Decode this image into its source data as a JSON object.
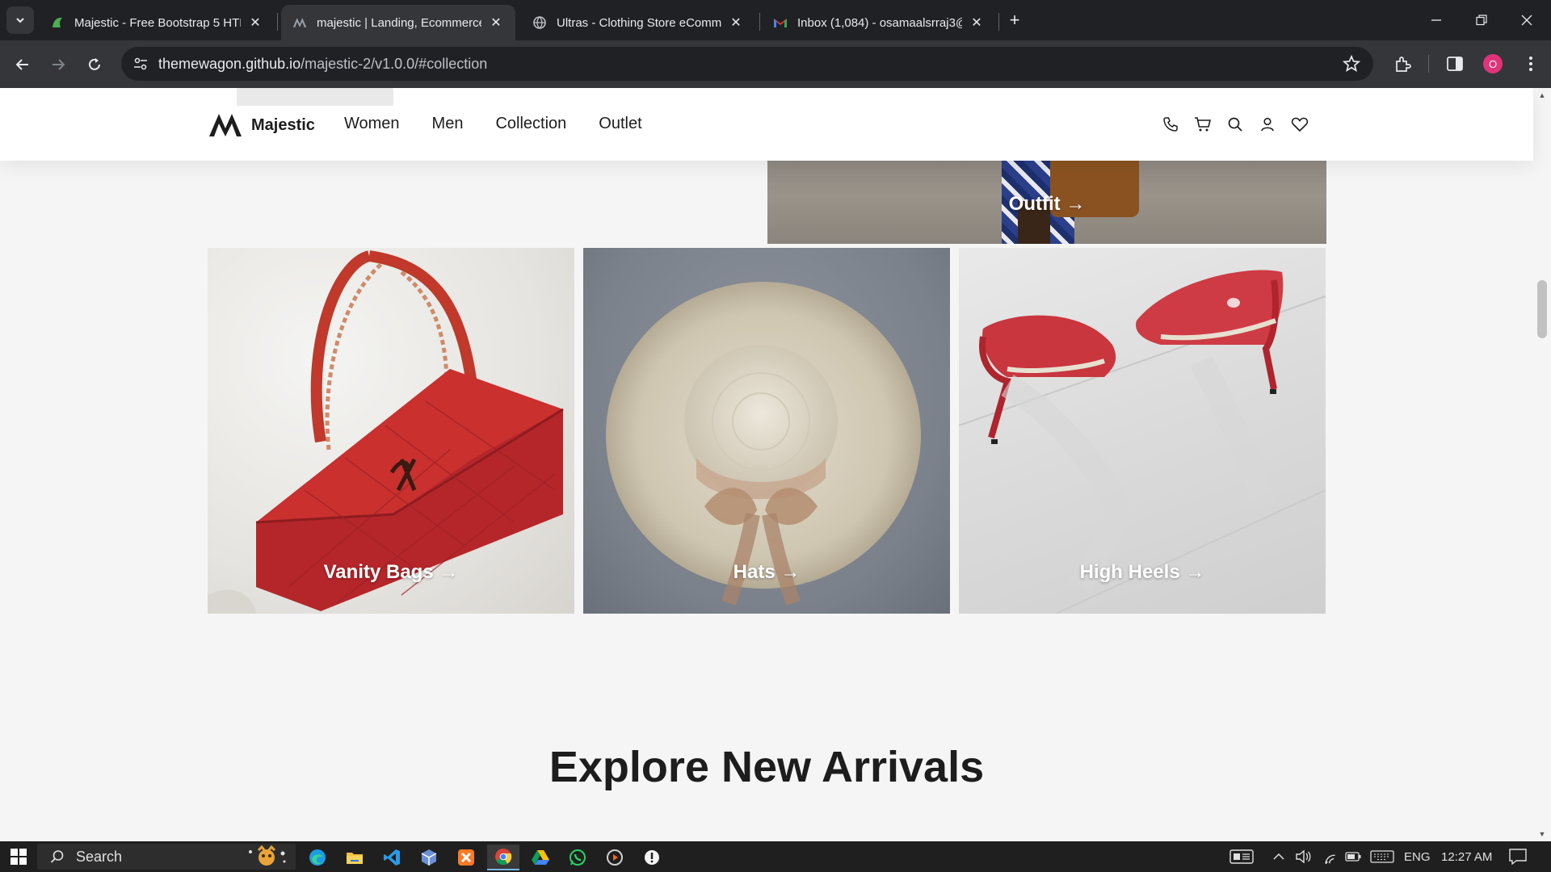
{
  "browser": {
    "tabs": [
      {
        "title": "Majestic - Free Bootstrap 5 HTM",
        "favicon": "majestic-green-icon",
        "active": false
      },
      {
        "title": "majestic | Landing, Ecommerce",
        "favicon": "majestic-logo-icon",
        "active": true
      },
      {
        "title": "Ultras - Clothing Store eComme",
        "favicon": "globe-icon",
        "active": false
      },
      {
        "title": "Inbox (1,084) - osamaalsrraj3@",
        "favicon": "gmail-icon",
        "active": false
      }
    ],
    "url_host": "themewagon.github.io",
    "url_path": "/majestic-2/v1.0.0/#collection",
    "profile_initial": "O",
    "accent": "#e0337a"
  },
  "site": {
    "brand": "Majestic",
    "nav": [
      "Women",
      "Men",
      "Collection",
      "Outlet"
    ],
    "header_icons": [
      "phone-icon",
      "cart-icon",
      "search-icon",
      "user-icon",
      "heart-icon"
    ]
  },
  "collection": {
    "outfit_label": "Outfit →",
    "cards": [
      {
        "label": "Vanity Bags →"
      },
      {
        "label": "Hats →"
      },
      {
        "label": "High Heels →"
      }
    ]
  },
  "arrivals": {
    "title": "Explore New Arrivals"
  },
  "taskbar": {
    "search_placeholder": "Search",
    "language": "ENG",
    "time": "12:27 AM"
  }
}
